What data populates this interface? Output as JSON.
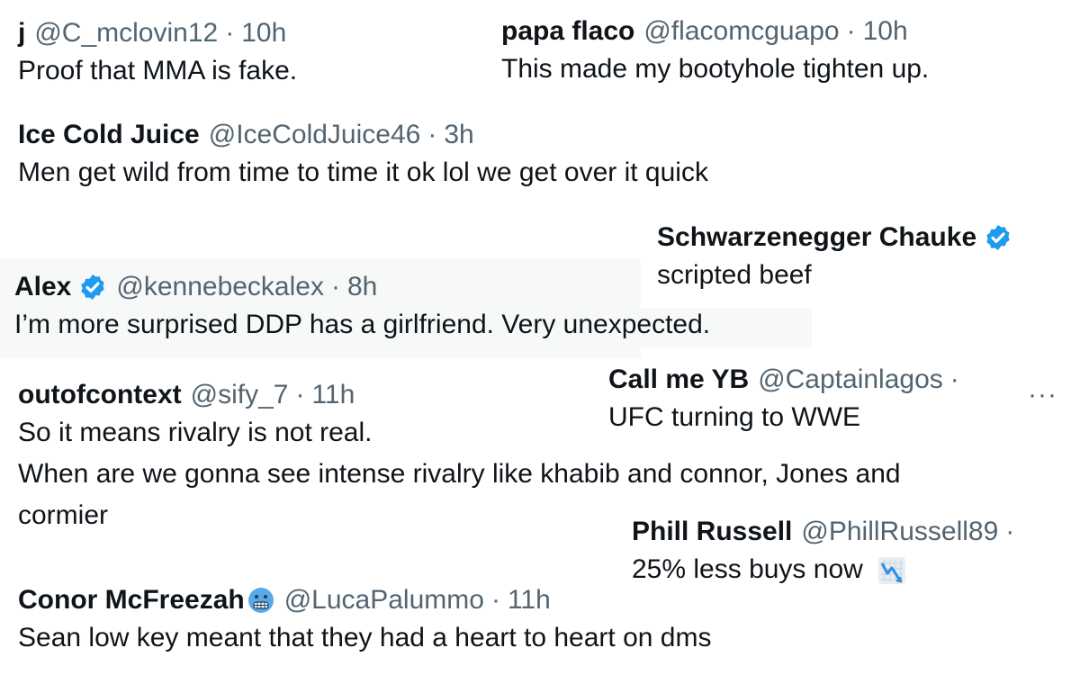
{
  "tweets": [
    {
      "name": "j",
      "handle": "@C_mclovin12",
      "sep": "·",
      "time": "10h",
      "text": "Proof that MMA is fake."
    },
    {
      "name": "papa flaco",
      "handle": "@flacomcguapo",
      "sep": "·",
      "time": "10h",
      "text": "This made my bootyhole tighten up."
    },
    {
      "name": "Ice Cold Juice",
      "handle": "@IceColdJuice46",
      "sep": "·",
      "time": "3h",
      "text": "Men get wild from time to time it ok lol we get over it quick"
    },
    {
      "name": "Schwarzenegger Chauke",
      "verified": true,
      "text": "scripted beef"
    },
    {
      "name": "Alex",
      "verified": true,
      "handle": "@kennebeckalex",
      "sep": "·",
      "time": "8h",
      "text": "I’m more surprised DDP has a girlfriend. Very unexpected."
    },
    {
      "name": "Call me YB",
      "handle": "@Captainlagos",
      "sep": "·",
      "text": "UFC turning to WWE",
      "more": "···"
    },
    {
      "name": "outofcontext",
      "handle": "@sify_7",
      "sep": "·",
      "time": "11h",
      "text_lines": [
        "So it means rivalry is not real.",
        "When are we gonna see intense rivalry like khabib and connor, Jones and",
        "cormier"
      ]
    },
    {
      "name": "Phill Russell",
      "handle": "@PhillRussell89",
      "sep": "·",
      "text": "25% less buys now",
      "emoji": "chart-decreasing-icon"
    },
    {
      "name": "Conor McFreezah",
      "name_emoji": "cold-face-icon",
      "handle": "@LucaPalummo",
      "sep": "·",
      "time": "11h",
      "text": "Sean low key meant that they had a heart to heart on dms"
    }
  ],
  "colors": {
    "text": "#0f1419",
    "secondary": "#536471",
    "verified": "#1d9bf0",
    "shade": "#f7f9f9"
  }
}
